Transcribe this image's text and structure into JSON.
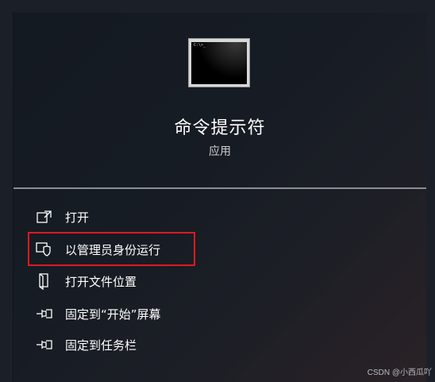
{
  "app": {
    "title": "命令提示符",
    "type": "应用",
    "icon": "command-prompt-icon",
    "icon_text": "C:\\>_"
  },
  "menu": {
    "items": [
      {
        "label": "打开",
        "icon": "open-icon"
      },
      {
        "label": "以管理员身份运行",
        "icon": "shield-icon"
      },
      {
        "label": "打开文件位置",
        "icon": "folder-icon"
      },
      {
        "label": "固定到“开始”屏幕",
        "icon": "pin-icon"
      },
      {
        "label": "固定到任务栏",
        "icon": "pin-icon"
      }
    ]
  },
  "highlight_color": "#e0191d",
  "watermark": "CSDN @小西瓜吖"
}
